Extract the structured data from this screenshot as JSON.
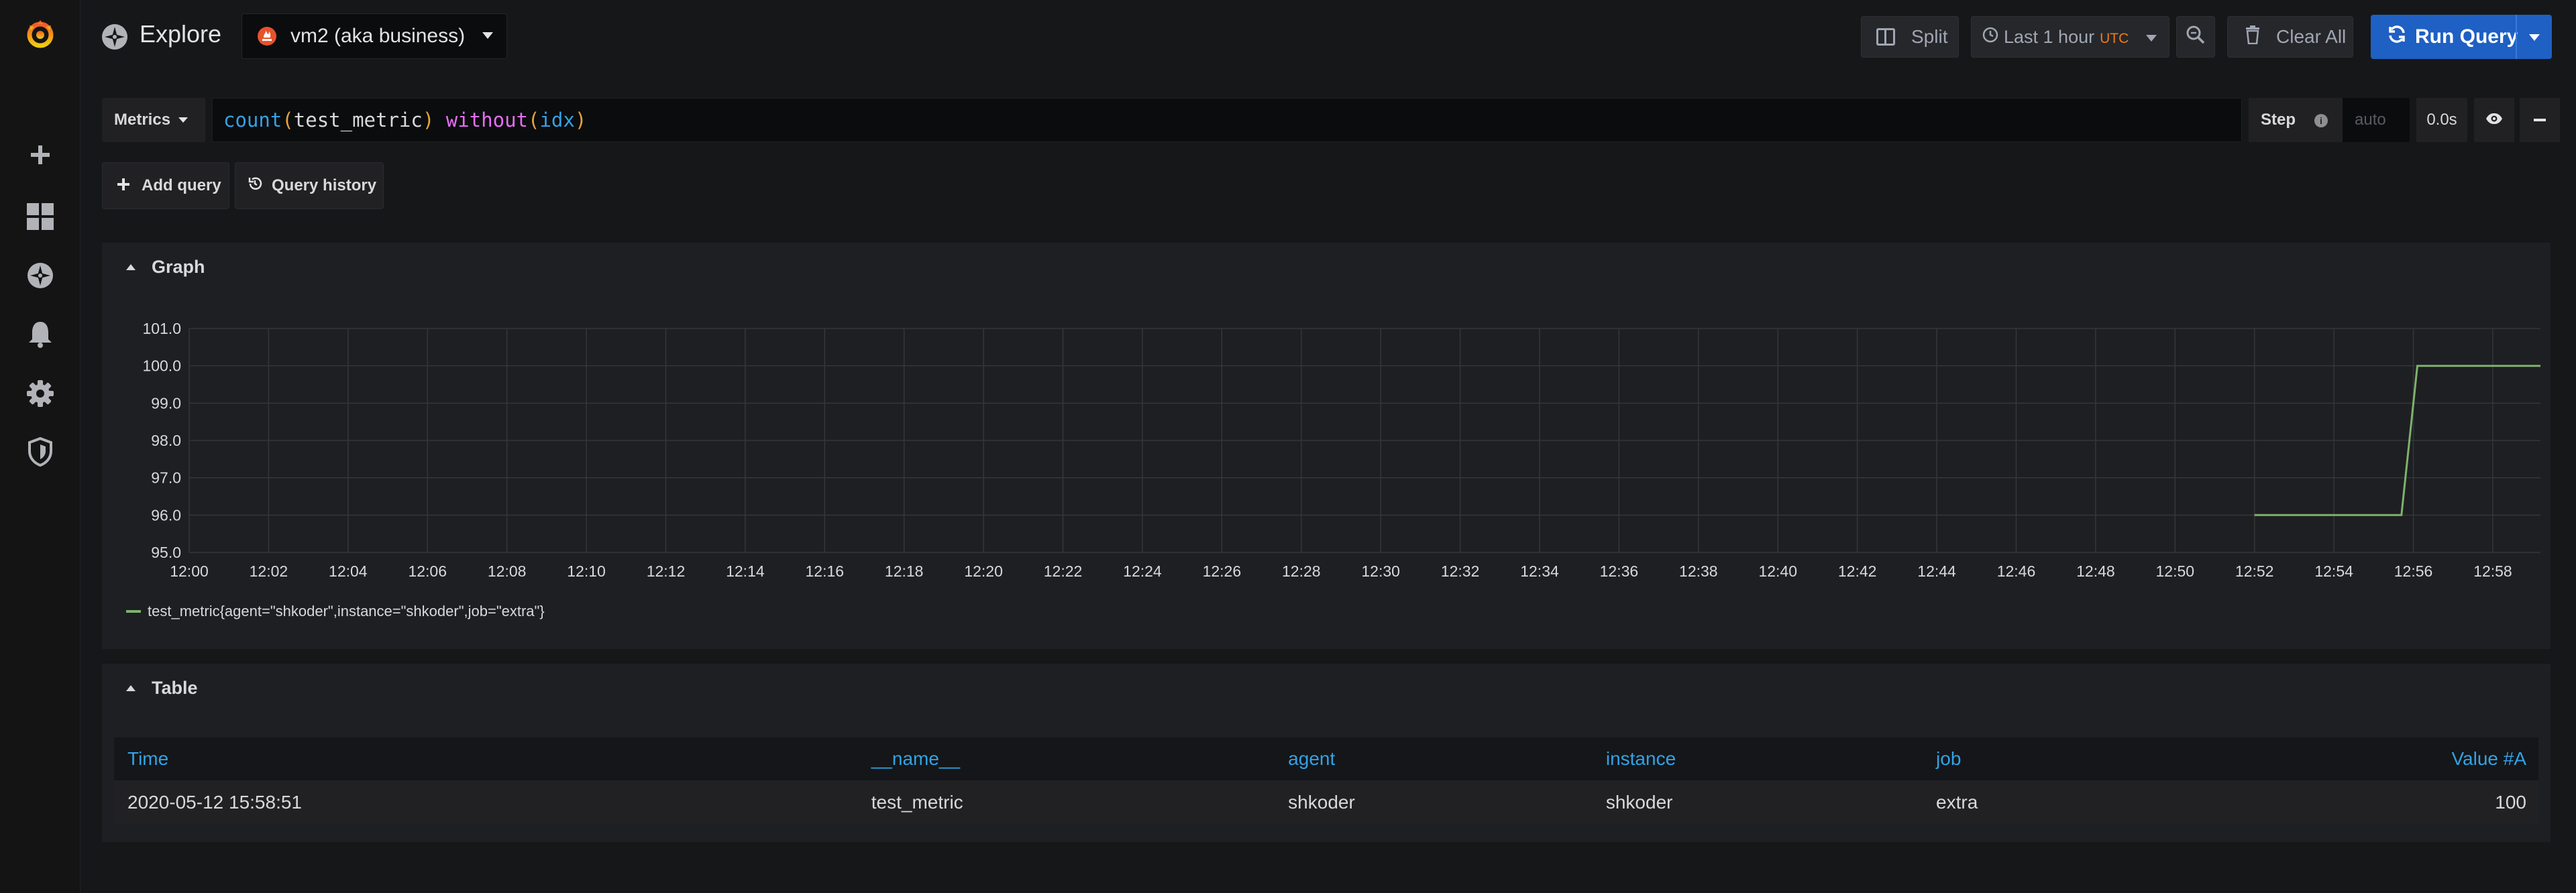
{
  "nav": {
    "title": "Explore",
    "datasource": "vm2 (aka business)",
    "split_label": "Split",
    "time_range": "Last 1 hour",
    "timezone": "UTC",
    "clear_label": "Clear All",
    "run_label": "Run Query"
  },
  "sidebar": {
    "icons": [
      "grafana-logo-icon",
      "plus-icon",
      "dashboards-icon",
      "explore-icon",
      "alerting-bell-icon",
      "gear-icon",
      "shield-icon"
    ]
  },
  "query": {
    "mode": "Metrics",
    "tokens": [
      {
        "text": "count",
        "kind": "fn"
      },
      {
        "text": "(",
        "kind": "paren"
      },
      {
        "text": "test_metric",
        "kind": "metric"
      },
      {
        "text": ")",
        "kind": "paren"
      },
      {
        "text": " ",
        "kind": "metric"
      },
      {
        "text": "without",
        "kind": "kw"
      },
      {
        "text": "(",
        "kind": "paren"
      },
      {
        "text": "idx",
        "kind": "fn"
      },
      {
        "text": ")",
        "kind": "paren"
      }
    ],
    "step_label": "Step",
    "step_placeholder": "auto",
    "duration": "0.0s",
    "add_query": "Add query",
    "query_history": "Query history"
  },
  "graph": {
    "title": "Graph",
    "legend": "test_metric{agent=\"shkoder\",instance=\"shkoder\",job=\"extra\"}"
  },
  "chart_data": {
    "type": "line",
    "x_ticks": [
      "12:00",
      "12:02",
      "12:04",
      "12:06",
      "12:08",
      "12:10",
      "12:12",
      "12:14",
      "12:16",
      "12:18",
      "12:20",
      "12:22",
      "12:24",
      "12:26",
      "12:28",
      "12:30",
      "12:32",
      "12:34",
      "12:36",
      "12:38",
      "12:40",
      "12:42",
      "12:44",
      "12:46",
      "12:48",
      "12:50",
      "12:52",
      "12:54",
      "12:56",
      "12:58"
    ],
    "y_ticks": [
      "101.0",
      "100.0",
      "99.0",
      "98.0",
      "97.0",
      "96.0",
      "95.0"
    ],
    "ylim": [
      95,
      101
    ],
    "xlim_minutes": [
      0,
      59.2
    ],
    "grid": true,
    "series": [
      {
        "name": "test_metric{agent=\"shkoder\",instance=\"shkoder\",job=\"extra\"}",
        "color": "#7eb26d",
        "points": [
          [
            52,
            96
          ],
          [
            55.7,
            96
          ],
          [
            56.1,
            100
          ],
          [
            59.2,
            100
          ]
        ]
      }
    ]
  },
  "table": {
    "title": "Table",
    "columns": [
      "Time",
      "__name__",
      "agent",
      "instance",
      "job",
      "Value #A"
    ],
    "rows": [
      [
        "2020-05-12 15:58:51",
        "test_metric",
        "shkoder",
        "shkoder",
        "extra",
        "100"
      ]
    ]
  },
  "colors": {
    "accent": "#1f60c4",
    "series": "#7eb26d",
    "link": "#33a2e5"
  }
}
